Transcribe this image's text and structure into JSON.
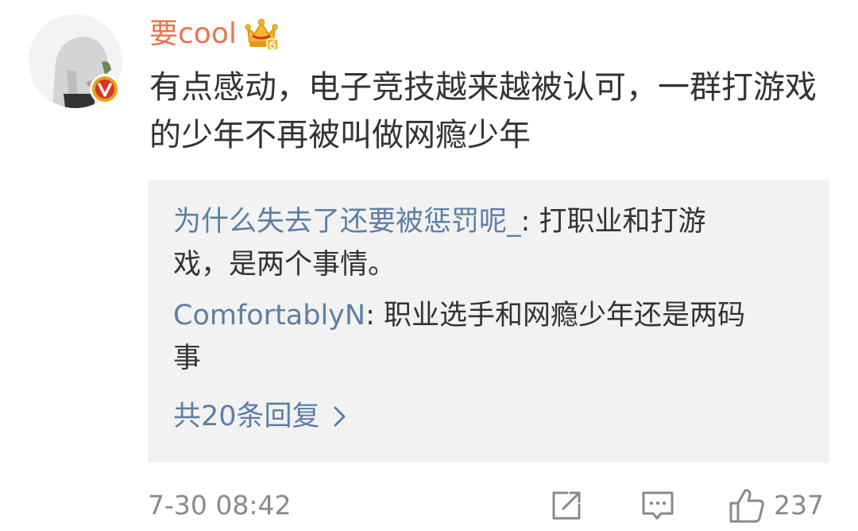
{
  "comment": {
    "username": "要cool",
    "text": "有点感动，电子竞技越来越被认可，一群打游戏的少年不再被叫做网瘾少年",
    "replies": [
      {
        "user": "为什么失去了还要被惩罚呢_",
        "separator": ": ",
        "text": "打职业和打游戏，是两个事情。"
      },
      {
        "user": "ComfortablyN",
        "separator": ": ",
        "text": "职业选手和网瘾少年还是两码事"
      }
    ],
    "more_replies_label": "共20条回复",
    "timestamp": "7-30 08:42",
    "like_count": "237",
    "icons": {
      "vip": "crown-vip-icon",
      "verified": "verified-v-icon",
      "share": "share-icon",
      "reply": "comment-icon",
      "like": "thumbs-up-icon",
      "more": "chevron-right-icon"
    },
    "colors": {
      "username": "#eb7350",
      "link": "#5d7fa6",
      "text": "#333333",
      "meta": "#8a8a8a",
      "reply_bg": "#f2f2f2",
      "verified_badge": "#e8a21a"
    }
  }
}
